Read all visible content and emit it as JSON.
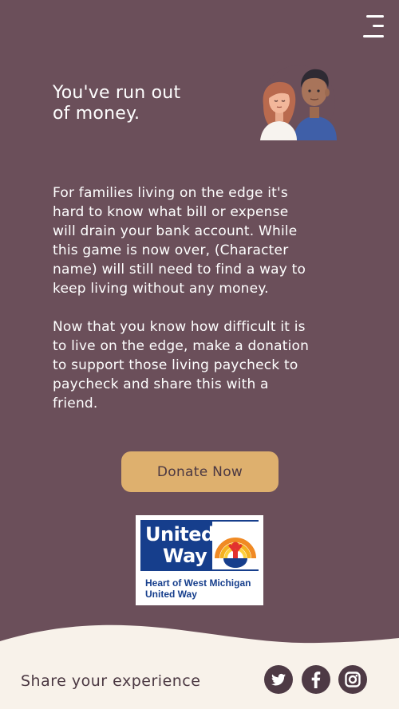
{
  "header": {
    "menu_icon": "hamburger-menu-icon"
  },
  "heading": {
    "title": "You've run out\nof money.",
    "illustration_icon": "couple-illustration"
  },
  "body": {
    "paragraph_1": "For families living on the edge it's\nhard to know what bill or expense\nwill drain your bank account. While\nthis game is now over, (Character\nname) will still need to find a way to\nkeep living without any money.",
    "paragraph_2": "Now that you know how difficult it is\nto live on the edge, make a donation\nto support those living paycheck to\npaycheck and share this with a\nfriend."
  },
  "donate": {
    "label": "Donate Now"
  },
  "sponsor_logo": {
    "name_line_1": "United",
    "name_line_2": "Way",
    "tagline_line_1": "Heart of West Michigan",
    "tagline_line_2": "United Way"
  },
  "footer": {
    "share_label": "Share your experience",
    "social": [
      {
        "icon": "twitter-icon"
      },
      {
        "icon": "facebook-icon"
      },
      {
        "icon": "instagram-icon"
      }
    ]
  },
  "colors": {
    "background": "#6b4f5a",
    "button": "#deb06e",
    "footer": "#f8f2ea",
    "social_icon_bg": "#4e3a45",
    "united_way_blue": "#163e8c"
  }
}
